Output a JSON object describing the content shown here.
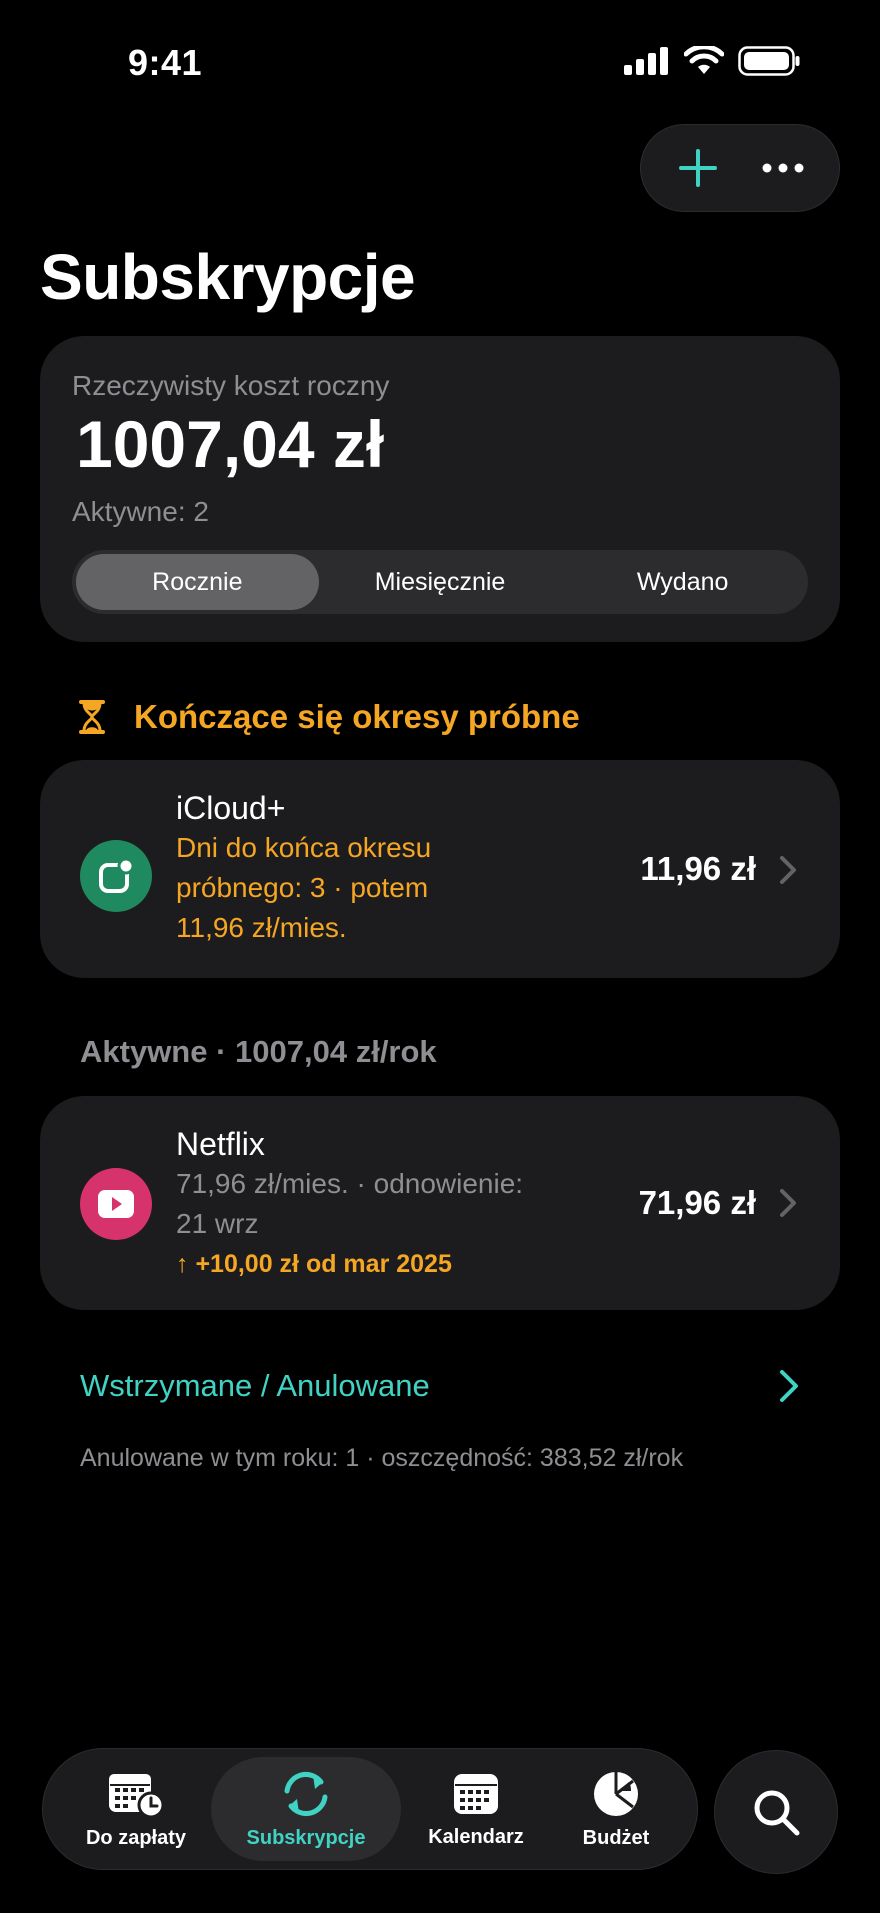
{
  "status": {
    "time": "9:41"
  },
  "title": "Subskrypcje",
  "summary": {
    "label": "Rzeczywisty koszt roczny",
    "amount": "1007,04 zł",
    "active": "Aktywne: 2",
    "segments": [
      "Rocznie",
      "Miesięcznie",
      "Wydano"
    ],
    "selected_segment": "Rocznie"
  },
  "trials": {
    "header": "Kończące się okresy próbne",
    "items": [
      {
        "name": "iCloud+",
        "line1": "Dni do końca okresu",
        "line2": "próbnego: 3 · potem",
        "line3": "11,96 zł/mies.",
        "price": "11,96 zł",
        "icon": "icloud-plus-icon",
        "icon_color": "#1f8a5f"
      }
    ]
  },
  "active": {
    "header": "Aktywne · 1007,04 zł/rok",
    "items": [
      {
        "name": "Netflix",
        "line1": "71,96 zł/mies. · odnowienie:",
        "line2": "21 wrz",
        "delta": "↑ +10,00 zł od mar 2025",
        "price": "71,96 zł",
        "icon": "play-icon",
        "icon_color": "#d6336c"
      }
    ]
  },
  "paused": {
    "label": "Wstrzymane / Anulowane",
    "note": "Anulowane w tym roku: 1 · oszczędność: 383,52 zł/rok"
  },
  "tabs": [
    {
      "label": "Do zapłaty",
      "icon": "calendar-clock-icon"
    },
    {
      "label": "Subskrypcje",
      "icon": "refresh-icon",
      "active": true
    },
    {
      "label": "Kalendarz",
      "icon": "calendar-icon"
    },
    {
      "label": "Budżet",
      "icon": "pie-chart-icon"
    }
  ],
  "colors": {
    "accent": "#40d3c4",
    "warning": "#f5a623",
    "card": "#1c1c1e",
    "background": "#000000"
  }
}
